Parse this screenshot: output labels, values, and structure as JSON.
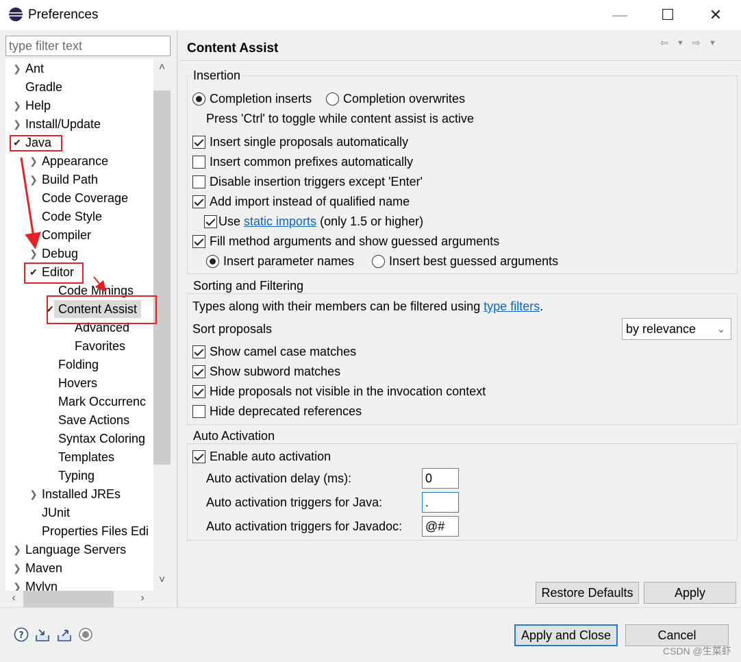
{
  "window": {
    "title": "Preferences",
    "minimize": "—",
    "maximize": "☐",
    "close": "✕"
  },
  "filter": {
    "placeholder": "type filter text"
  },
  "tree": {
    "ant": "Ant",
    "gradle": "Gradle",
    "help": "Help",
    "install_update": "Install/Update",
    "java": "Java",
    "appearance": "Appearance",
    "build_path": "Build Path",
    "code_coverage": "Code Coverage",
    "code_style": "Code Style",
    "compiler": "Compiler",
    "debug": "Debug",
    "editor": "Editor",
    "code_minings": "Code Minings",
    "content_assist": "Content Assist",
    "advanced": "Advanced",
    "favorites": "Favorites",
    "folding": "Folding",
    "hovers": "Hovers",
    "mark_occurrences": "Mark Occurrenc",
    "save_actions": "Save Actions",
    "syntax_coloring": "Syntax Coloring",
    "templates": "Templates",
    "typing": "Typing",
    "installed_jres": "Installed JREs",
    "junit": "JUnit",
    "properties_files_editor": "Properties Files Edi",
    "language_servers": "Language Servers",
    "maven": "Maven",
    "mylyn": "Mylyn"
  },
  "page": {
    "title": "Content Assist",
    "insertion": {
      "title": "Insertion",
      "completion_inserts": "Completion inserts",
      "completion_overwrites": "Completion overwrites",
      "toggle_hint": "Press 'Ctrl' to toggle while content assist is active",
      "insert_single": "Insert single proposals automatically",
      "insert_common": "Insert common prefixes automatically",
      "disable_triggers": "Disable insertion triggers except 'Enter'",
      "add_import": "Add import instead of qualified name",
      "use_prefix": "Use",
      "static_imports_link": "static imports",
      "static_suffix": "(only 1.5 or higher)",
      "fill_method_args": "Fill method arguments and show guessed arguments",
      "insert_param_names": "Insert parameter names",
      "insert_best_guessed": "Insert best guessed arguments"
    },
    "sorting": {
      "title": "Sorting and Filtering",
      "types_text": "Types along with their members can be filtered using",
      "type_filters_link": "type filters",
      "period": ".",
      "sort_label": "Sort proposals",
      "sort_value": "by relevance",
      "camel_case": "Show camel case matches",
      "subword": "Show subword matches",
      "hide_not_visible": "Hide proposals not visible in the invocation context",
      "hide_deprecated": "Hide deprecated references"
    },
    "auto": {
      "title": "Auto Activation",
      "enable": "Enable auto activation",
      "delay_label": "Auto activation delay (ms):",
      "delay_value": "0",
      "java_label": "Auto activation triggers for Java:",
      "java_value": ".",
      "javadoc_label": "Auto activation triggers for Javadoc:",
      "javadoc_value": "@#"
    },
    "restore_defaults": "Restore Defaults",
    "apply": "Apply"
  },
  "footer": {
    "apply_and_close": "Apply and Close",
    "cancel": "Cancel",
    "watermark": "CSDN @生菜虾"
  },
  "colors": {
    "highlight": "#e52222",
    "link": "#0a64c8",
    "focus": "#1b7bd6"
  },
  "icons": [
    "help-icon",
    "import-icon",
    "export-icon",
    "record-icon",
    "back-arrow-icon",
    "forward-arrow-icon",
    "menu-dropdown-icon"
  ]
}
